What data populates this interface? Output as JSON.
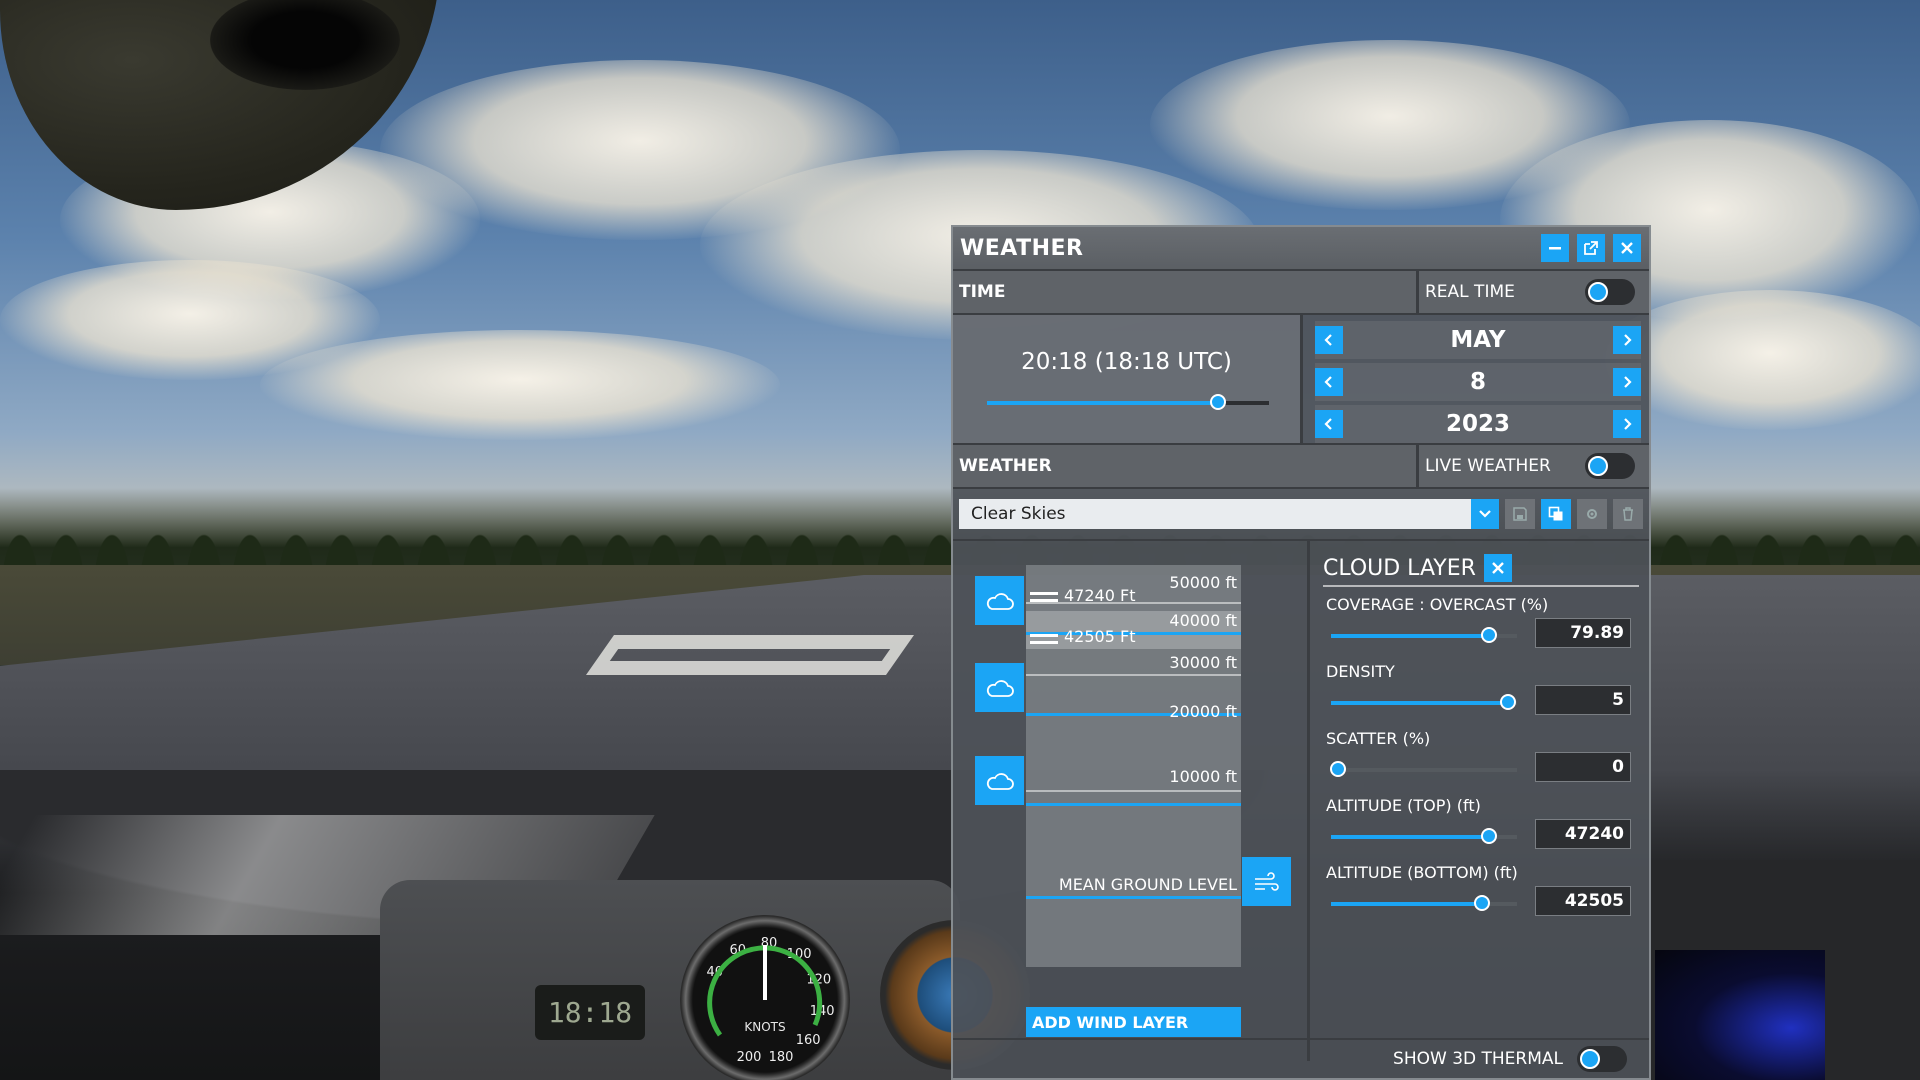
{
  "window": {
    "title": "WEATHER"
  },
  "time": {
    "section_label": "TIME",
    "realtime_label": "REAL TIME",
    "realtime_on": false,
    "display": "20:18 (18:18 UTC)",
    "slider_fraction": 0.82,
    "month": "MAY",
    "day": "8",
    "year": "2023"
  },
  "weather": {
    "section_label": "WEATHER",
    "live_label": "LIVE WEATHER",
    "live_on": false,
    "preset": "Clear Skies"
  },
  "layers": {
    "altitudes": [
      "50000 ft",
      "40000 ft",
      "30000 ft",
      "20000 ft",
      "10000 ft"
    ],
    "top_handle": "47240 Ft",
    "bottom_handle": "42505 Ft",
    "ground_label": "MEAN GROUND LEVEL",
    "add_wind_label": "ADD WIND LAYER"
  },
  "cloud_layer": {
    "title": "CLOUD LAYER",
    "props": [
      {
        "label": "COVERAGE : OVERCAST (%)",
        "value": "79.89",
        "fraction": 0.85
      },
      {
        "label": "DENSITY",
        "value": "5",
        "fraction": 0.95
      },
      {
        "label": "SCATTER (%)",
        "value": "0",
        "fraction": 0.04
      },
      {
        "label": "ALTITUDE (TOP) (ft)",
        "value": "47240",
        "fraction": 0.85
      },
      {
        "label": "ALTITUDE (BOTTOM) (ft)",
        "value": "42505",
        "fraction": 0.81
      }
    ]
  },
  "footer": {
    "thermal_label": "SHOW 3D THERMAL",
    "thermal_on": false
  },
  "cockpit": {
    "clock": "18:18",
    "asi_labels": [
      "40",
      "60",
      "80",
      "100",
      "120",
      "140",
      "160",
      "180",
      "200"
    ],
    "asi_unit": "KNOTS"
  },
  "colors": {
    "accent": "#1ba5f5",
    "panel": "#4e5258"
  }
}
